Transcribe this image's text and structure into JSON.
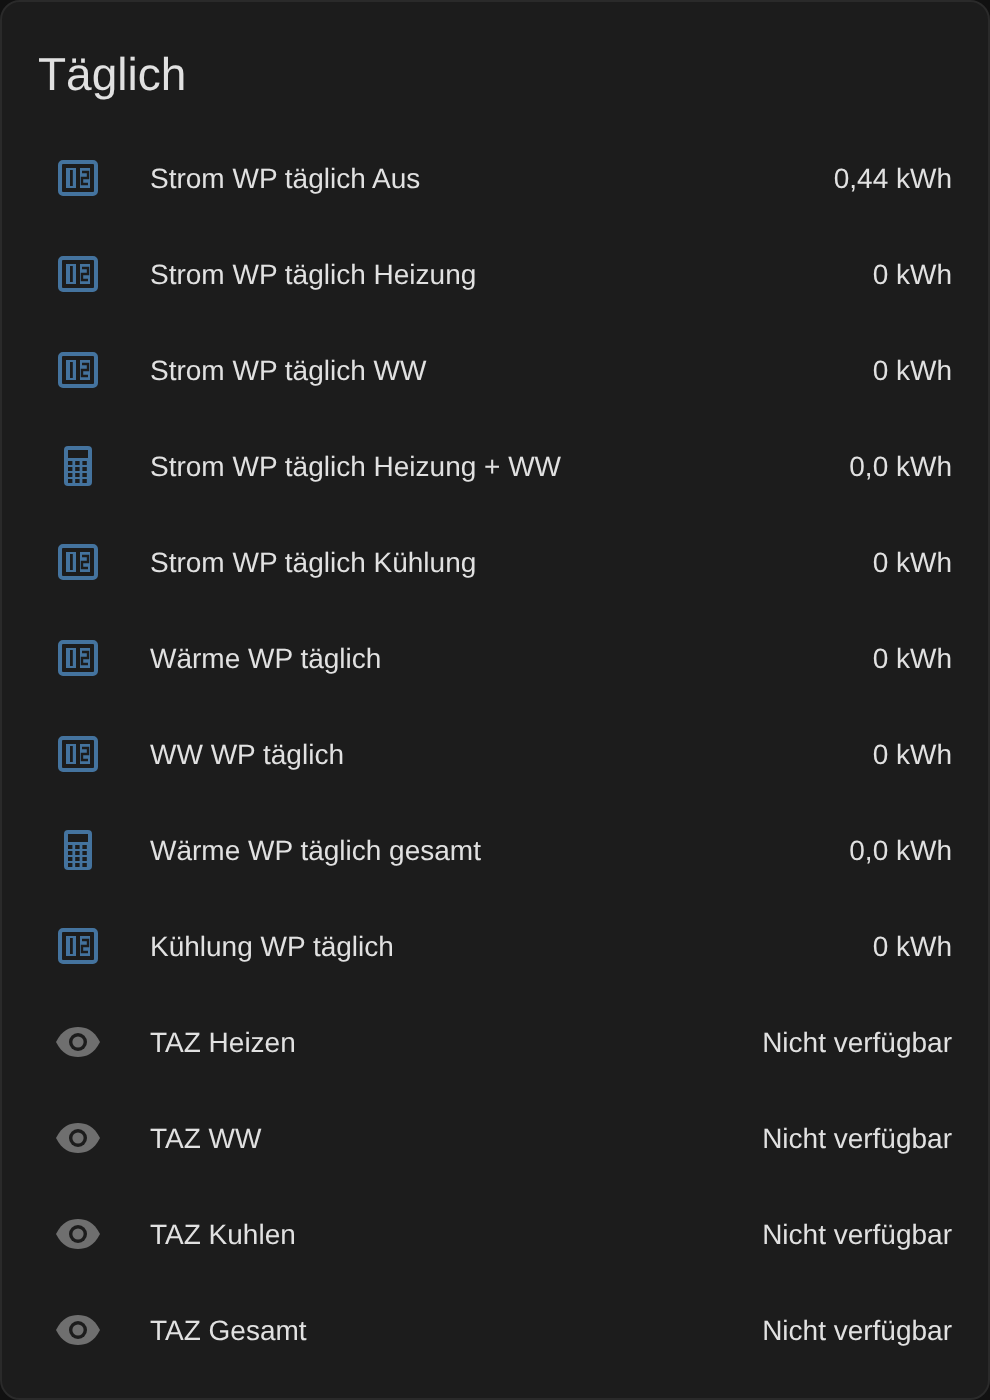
{
  "card": {
    "title": "Täglich"
  },
  "rows": [
    {
      "kind": "counter",
      "name": "Strom WP täglich Aus",
      "value": "0,44 kWh"
    },
    {
      "kind": "counter",
      "name": "Strom WP täglich Heizung",
      "value": "0 kWh"
    },
    {
      "kind": "counter",
      "name": "Strom WP täglich WW",
      "value": "0 kWh"
    },
    {
      "kind": "calculator",
      "name": "Strom WP täglich Heizung + WW",
      "value": "0,0 kWh"
    },
    {
      "kind": "counter",
      "name": "Strom WP täglich Kühlung",
      "value": "0 kWh"
    },
    {
      "kind": "counter",
      "name": "Wärme WP täglich",
      "value": "0 kWh"
    },
    {
      "kind": "counter",
      "name": "WW WP täglich",
      "value": "0 kWh"
    },
    {
      "kind": "calculator",
      "name": "Wärme WP täglich gesamt",
      "value": "0,0 kWh"
    },
    {
      "kind": "counter",
      "name": "Kühlung WP täglich",
      "value": "0 kWh"
    },
    {
      "kind": "eye",
      "name": "TAZ Heizen",
      "value": "Nicht verfügbar"
    },
    {
      "kind": "eye",
      "name": "TAZ WW",
      "value": "Nicht verfügbar"
    },
    {
      "kind": "eye",
      "name": "TAZ Kuhlen",
      "value": "Nicht verfügbar"
    },
    {
      "kind": "eye",
      "name": "TAZ Gesamt",
      "value": "Nicht verfügbar"
    }
  ]
}
